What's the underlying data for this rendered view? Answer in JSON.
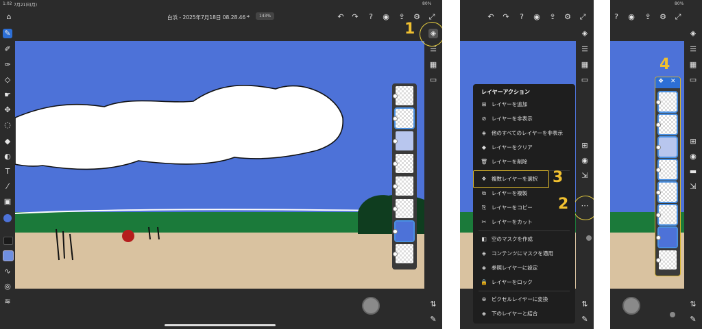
{
  "status": {
    "time": "1:02",
    "date": "7月21日(月)",
    "battery": "80%"
  },
  "doc_title": {
    "name": "白浜 - 2025年7月18日 08.28.46 *",
    "zoom": "143%"
  },
  "layer_actions": {
    "title": "レイヤーアクション",
    "items": [
      {
        "icon": "⊞",
        "label": "レイヤーを追加"
      },
      {
        "icon": "⊘",
        "label": "レイヤーを非表示"
      },
      {
        "icon": "◈",
        "label": "他のすべてのレイヤーを非表示"
      },
      {
        "icon": "◆",
        "label": "レイヤーをクリア"
      },
      {
        "icon": "🗑",
        "label": "レイヤーを削除"
      },
      {
        "icon": "❖",
        "label": "複数レイヤーを選択"
      },
      {
        "icon": "⧉",
        "label": "レイヤーを複製"
      },
      {
        "icon": "⎘",
        "label": "レイヤーをコピー"
      },
      {
        "icon": "✂",
        "label": "レイヤーをカット"
      },
      {
        "icon": "◧",
        "label": "空のマスクを作成"
      },
      {
        "icon": "◈",
        "label": "コンテンツにマスクを適用"
      },
      {
        "icon": "◈",
        "label": "参照レイヤーに設定"
      },
      {
        "icon": "🔒",
        "label": "レイヤーをロック"
      },
      {
        "icon": "⊕",
        "label": "ピクセルレイヤーに変換"
      },
      {
        "icon": "◈",
        "label": "下のレイヤーと結合"
      }
    ]
  },
  "annotations": {
    "step1": "1",
    "step2": "2",
    "step3": "3",
    "step4": "4"
  },
  "layer_panel_header": {
    "close": "✕"
  },
  "icons": {
    "home": "home-icon",
    "undo": "undo-icon",
    "redo": "redo-icon",
    "help": "help-icon",
    "share": "share-icon",
    "settings": "gear-icon",
    "layers": "layers-icon",
    "more": "more-icon"
  }
}
